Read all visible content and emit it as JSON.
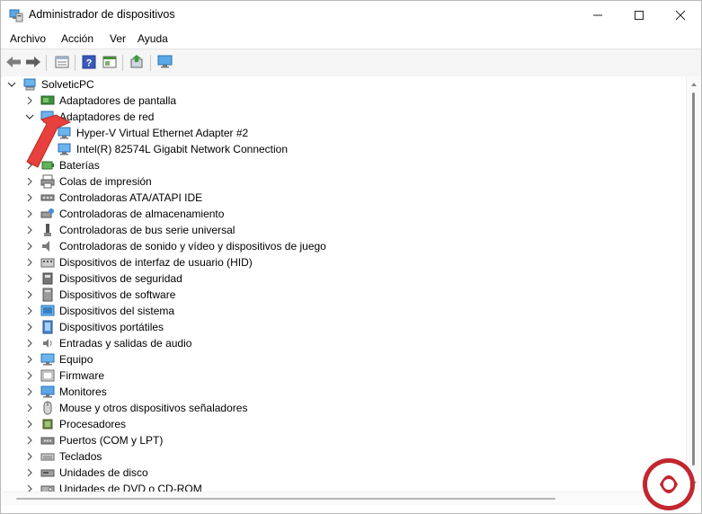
{
  "window": {
    "title": "Administrador de dispositivos"
  },
  "menu": [
    "Archivo",
    "Acción",
    "Ver",
    "Ayuda"
  ],
  "tree": {
    "root": "SolveticPC",
    "items": [
      {
        "label": "Adaptadores de pantalla",
        "icon": "display-adapter-icon",
        "expanded": false
      },
      {
        "label": "Adaptadores de red",
        "icon": "network-adapter-icon",
        "expanded": true,
        "children": [
          "Hyper-V Virtual Ethernet Adapter #2",
          "Intel(R) 82574L Gigabit Network Connection"
        ]
      },
      {
        "label": "Baterías",
        "icon": "battery-icon",
        "expanded": false
      },
      {
        "label": "Colas de impresión",
        "icon": "printer-icon",
        "expanded": false
      },
      {
        "label": "Controladoras ATA/ATAPI IDE",
        "icon": "ide-controller-icon",
        "expanded": false
      },
      {
        "label": "Controladoras de almacenamiento",
        "icon": "storage-controller-icon",
        "expanded": false
      },
      {
        "label": "Controladoras de bus serie universal",
        "icon": "usb-icon",
        "expanded": false
      },
      {
        "label": "Controladoras de sonido y vídeo y dispositivos de juego",
        "icon": "speaker-icon",
        "expanded": false
      },
      {
        "label": "Dispositivos de interfaz de usuario (HID)",
        "icon": "hid-icon",
        "expanded": false
      },
      {
        "label": "Dispositivos de seguridad",
        "icon": "security-device-icon",
        "expanded": false
      },
      {
        "label": "Dispositivos de software",
        "icon": "software-device-icon",
        "expanded": false
      },
      {
        "label": "Dispositivos del sistema",
        "icon": "system-device-icon",
        "expanded": false
      },
      {
        "label": "Dispositivos portátiles",
        "icon": "portable-device-icon",
        "expanded": false
      },
      {
        "label": "Entradas y salidas de audio",
        "icon": "audio-io-icon",
        "expanded": false
      },
      {
        "label": "Equipo",
        "icon": "computer-icon",
        "expanded": false
      },
      {
        "label": "Firmware",
        "icon": "firmware-icon",
        "expanded": false
      },
      {
        "label": "Monitores",
        "icon": "monitor-icon",
        "expanded": false
      },
      {
        "label": "Mouse y otros dispositivos señaladores",
        "icon": "mouse-icon",
        "expanded": false
      },
      {
        "label": "Procesadores",
        "icon": "processor-icon",
        "expanded": false
      },
      {
        "label": "Puertos (COM y LPT)",
        "icon": "port-icon",
        "expanded": false
      },
      {
        "label": "Teclados",
        "icon": "keyboard-icon",
        "expanded": false
      },
      {
        "label": "Unidades de disco",
        "icon": "disk-drive-icon",
        "expanded": false
      },
      {
        "label": "Unidades de DVD o CD-ROM",
        "icon": "dvd-drive-icon",
        "expanded": false
      }
    ]
  },
  "colors": {
    "accent": "#0067c0",
    "arrow": "#e8403c",
    "logo": "#c2262e"
  }
}
